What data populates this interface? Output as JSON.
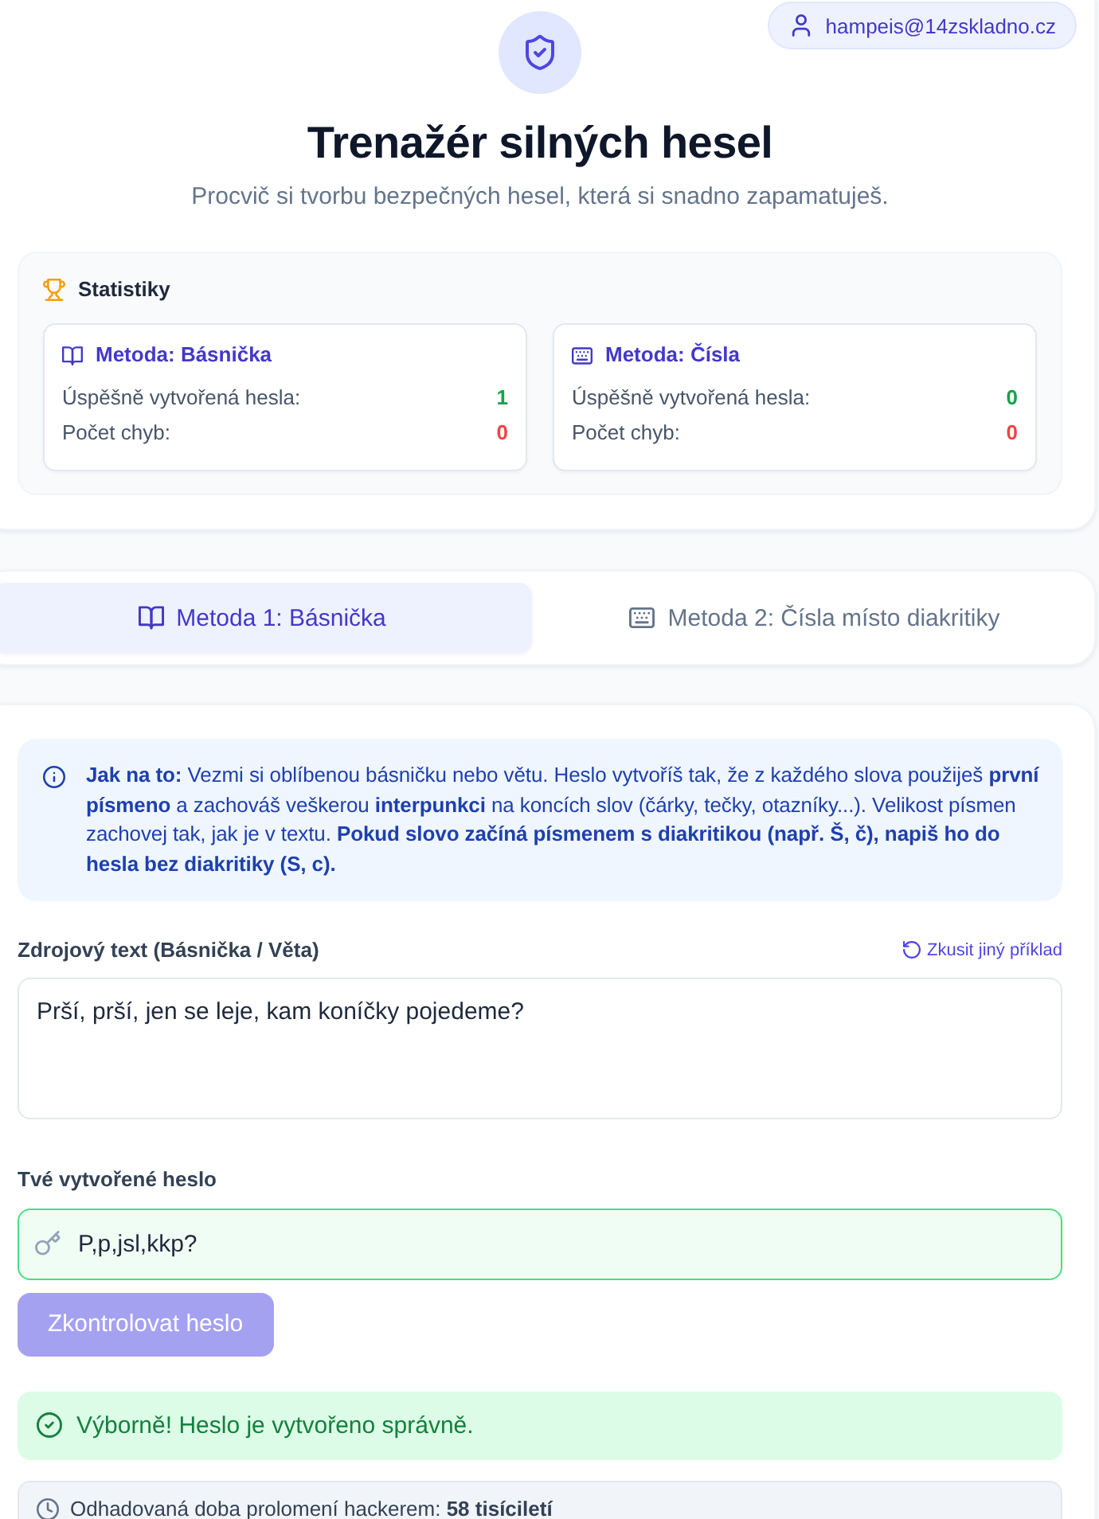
{
  "user_badge": {
    "email": "hampeis@14zskladno.cz"
  },
  "header": {
    "title": "Trenažér silných hesel",
    "subtitle": "Procvič si tvorbu bezpečných hesel, která si snadno zapamatuješ."
  },
  "statistics": {
    "title": "Statistiky",
    "methods": [
      {
        "kind": "poem",
        "title": "Metoda: Básnička",
        "rows": [
          {
            "label": "Úspěšně vytvořená hesla:",
            "value": "1",
            "kind": "success"
          },
          {
            "label": "Počet chyb:",
            "value": "0",
            "kind": "error"
          }
        ]
      },
      {
        "kind": "numbers",
        "title": "Metoda: Čísla",
        "rows": [
          {
            "label": "Úspěšně vytvořená hesla:",
            "value": "0",
            "kind": "success"
          },
          {
            "label": "Počet chyb:",
            "value": "0",
            "kind": "error"
          }
        ]
      }
    ]
  },
  "tabs": [
    {
      "label": "Metoda 1: Básnička",
      "kind": "poem",
      "selected": true
    },
    {
      "label": "Metoda 2: Čísla místo diakritiky",
      "kind": "numbers",
      "selected": false
    }
  ],
  "instructions": {
    "text": "**Jak na to:** Vezmi si oblíbenou básničku nebo větu. Heslo vytvoříš tak, že z každého slova použiješ **první písmeno** a zachováš veškerou **interpunkci** na koncích slov (čárky, tečky, otazníky...). Velikost písmen zachovej tak, jak je v textu. **Pokud slovo začíná písmenem s diakritikou (např. Š, č), napiš ho do hesla bez diakritiky (S, c).**"
  },
  "source_text": {
    "label": "Zdrojový text (Básnička / Věta)",
    "action": "Zkusit jiný příklad",
    "value": "Prší, prší, jen se leje, kam koníčky pojedeme?"
  },
  "password": {
    "label": "Tvé vytvořené heslo",
    "value": "P,p,jsl,kkp?",
    "valid": true
  },
  "check_button": {
    "label": "Zkontrolovat heslo",
    "disabled": true
  },
  "result": {
    "kind": "success",
    "message": "Výborně! Heslo je vytvořeno správně."
  },
  "crack_time": {
    "text": "Odhadovaná doba prolomení hackerem: **58 tisíciletí**"
  }
}
